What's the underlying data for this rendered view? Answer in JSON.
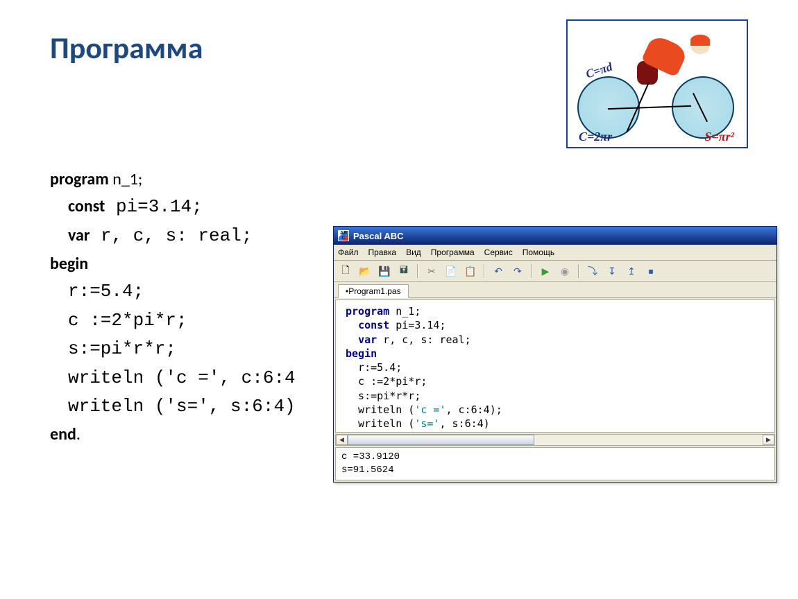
{
  "slide": {
    "title": "Программа"
  },
  "illustration": {
    "formula_c_1": "С=πd",
    "formula_c_2": "С=2πr",
    "formula_s": "S=πr²"
  },
  "code_listing": {
    "l1_kw": "program",
    "l1_rest": " n_1;",
    "l2_kw": "const",
    "l2_rest": " pi=3.14;",
    "l3_kw": "var",
    "l3_rest": " r, c, s: real;",
    "l4_kw": "begin",
    "l5": "r:=5.4;",
    "l6": "c :=2*pi*r;",
    "l7": "s:=pi*r*r;",
    "l8": "writeln ('c =', c:6:4",
    "l9": "writeln ('s=', s:6:4)",
    "l10_kw": "end",
    "l10_rest": "."
  },
  "pascal_window": {
    "title": "Pascal ABC",
    "menu": {
      "file": "Файл",
      "edit": "Правка",
      "view": "Вид",
      "program": "Программа",
      "service": "Сервис",
      "help": "Помощь"
    },
    "tab": "•Program1.pas",
    "editor": {
      "l1a": "program",
      "l1b": " n_1;",
      "l2a": "const",
      "l2b": " pi=3.14;",
      "l3a": "var",
      "l3b": " r, c, s: real;",
      "l4": "begin",
      "l5": "  r:=5.4;",
      "l6": "  c :=2*pi*r;",
      "l7": "  s:=pi*r*r;",
      "l8a": "  writeln (",
      "l8s": "'c ='",
      "l8b": ", c:6:4);",
      "l9a": "  writeln (",
      "l9s": "'s='",
      "l9b": ", s:6:4)"
    },
    "output": "c =33.9120\ns=91.5624"
  },
  "icons": {
    "new": "🗋",
    "open": "📂",
    "save": "💾",
    "saveall": "🖬",
    "cut": "✂",
    "copy": "📄",
    "paste": "📋",
    "undo": "↶",
    "redo": "↷",
    "run": "▶",
    "stop": "◉",
    "stepover": "⤵",
    "stepinto": "↧",
    "stepout": "↥",
    "breakpoint": "⏹"
  },
  "colors": {
    "title": "#1f497d",
    "xp_blue_top": "#3b77dd",
    "xp_blue_bottom": "#0a246a",
    "win_bg": "#ece9d8",
    "keyword": "#000080",
    "string": "#008080",
    "run_green": "#3a9b35",
    "stop_grey": "#9a9a9a"
  }
}
